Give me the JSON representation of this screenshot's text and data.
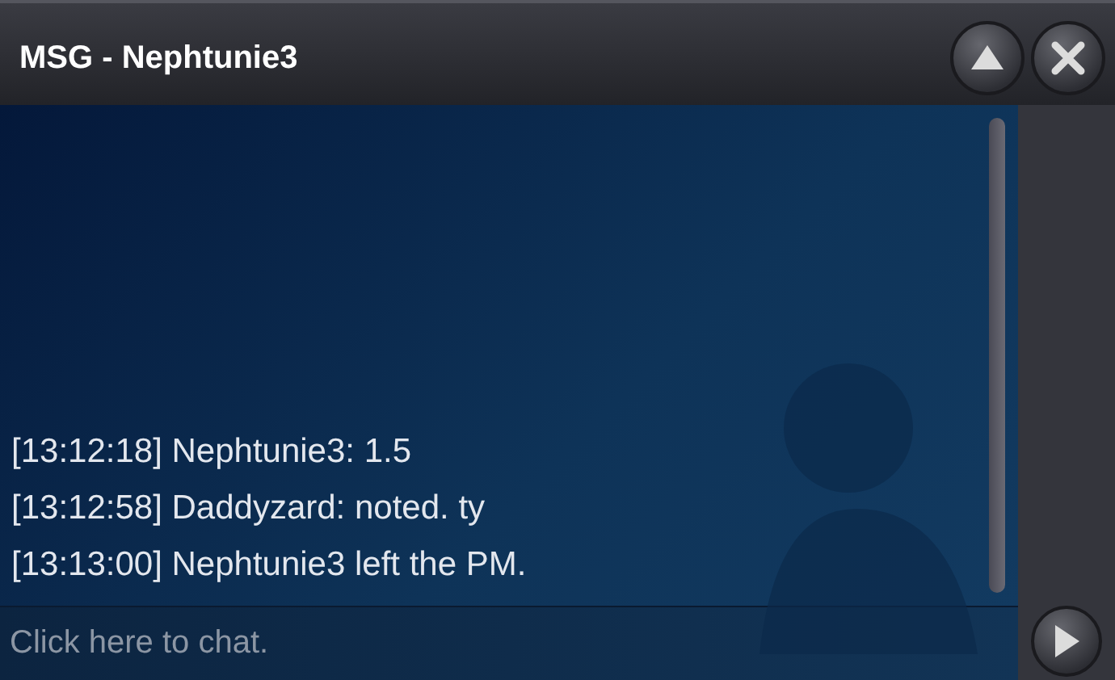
{
  "window": {
    "title": "MSG - Nephtunie3"
  },
  "messages": [
    {
      "text": "[13:12:18] Nephtunie3: 1.5"
    },
    {
      "text": "[13:12:58] Daddyzard: noted. ty"
    },
    {
      "text": "[13:13:00] Nephtunie3 left the PM."
    }
  ],
  "chat_input": {
    "placeholder": "Click here to chat."
  }
}
